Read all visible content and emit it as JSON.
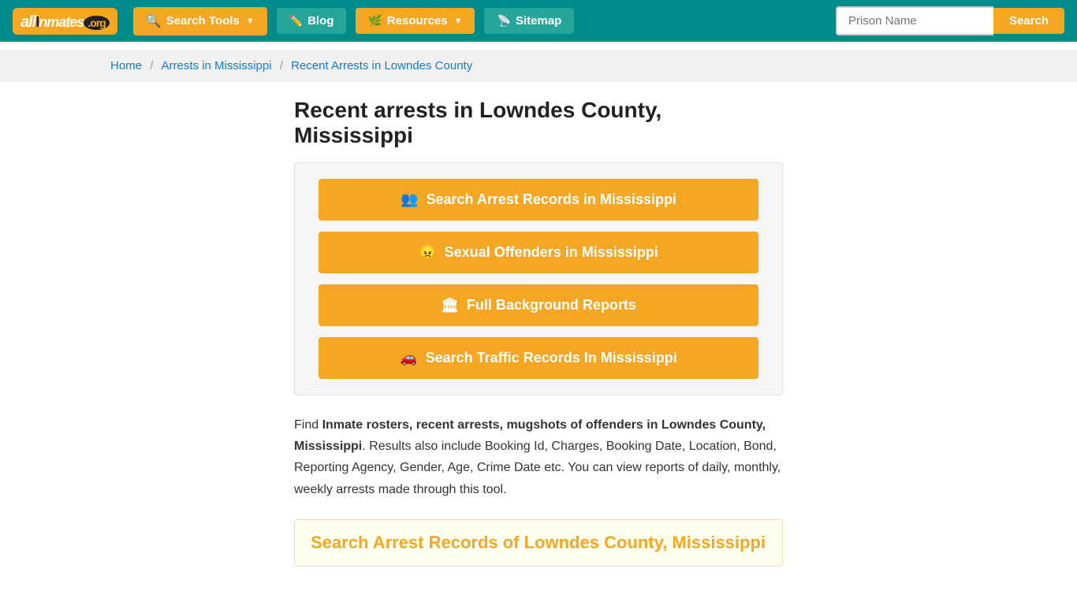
{
  "header": {
    "logo_text": "allInmates.org",
    "logo_all": "all",
    "logo_inmates": "Inmates",
    "logo_org": ".org",
    "nav": {
      "search_tools_label": "Search Tools",
      "blog_label": "Blog",
      "resources_label": "Resources",
      "sitemap_label": "Sitemap"
    },
    "search_placeholder": "Prison Name",
    "search_button_label": "Search"
  },
  "breadcrumb": {
    "home": "Home",
    "arrests": "Arrests in Mississippi",
    "current": "Recent Arrests in Lowndes County"
  },
  "main": {
    "page_title": "Recent arrests in Lowndes County, Mississippi",
    "buttons": [
      {
        "id": "arrest-records",
        "icon": "users",
        "label": "Search Arrest Records in Mississippi"
      },
      {
        "id": "sexual-offenders",
        "icon": "offender",
        "label": "Sexual Offenders in Mississippi"
      },
      {
        "id": "background-reports",
        "icon": "building",
        "label": "Full Background Reports"
      },
      {
        "id": "traffic-records",
        "icon": "car",
        "label": "Search Traffic Records In Mississippi"
      }
    ],
    "description_prefix": "Find ",
    "description_bold": "Inmate rosters, recent arrests, mugshots of offenders in Lowndes County, Mississippi",
    "description_rest": ". Results also include Booking Id, Charges, Booking Date, Location, Bond, Reporting Agency, Gender, Age, Crime Date etc. You can view reports of daily, monthly, weekly arrests made through this tool.",
    "search_records_title": "Search Arrest Records of Lowndes County, Mississippi"
  }
}
